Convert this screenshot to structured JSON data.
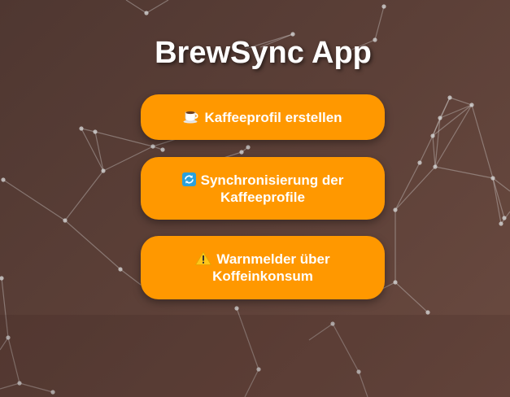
{
  "app": {
    "title": "BrewSync App"
  },
  "actions": [
    {
      "icon": "coffee-cup-icon",
      "label": "Kaffeeprofil erstellen"
    },
    {
      "icon": "sync-arrows-icon",
      "label": "Synchronisierung der Kaffeeprofile"
    },
    {
      "icon": "warning-icon",
      "label": "Warnmelder über Koffeinkonsum"
    }
  ],
  "colors": {
    "background": "#5b3f37",
    "button": "#ff9800",
    "button_text": "#ffffff",
    "sync_icon": "#2aa1dc"
  }
}
